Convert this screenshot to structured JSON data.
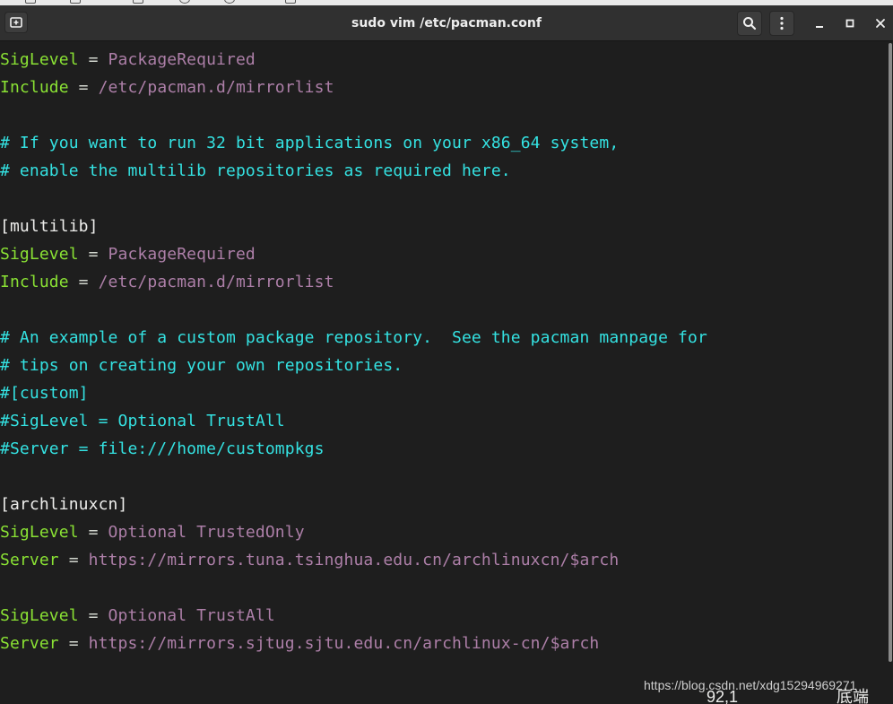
{
  "window": {
    "title": "sudo vim /etc/pacman.conf"
  },
  "titlebar": {
    "new_tab_icon": "new-tab-icon",
    "search_icon": "search-icon",
    "menu_icon": "kebab-menu-icon",
    "minimize_icon": "minimize-icon",
    "maximize_icon": "maximize-icon",
    "close_icon": "close-icon"
  },
  "editor": {
    "lines": [
      {
        "key": "SigLevel",
        "op": " = ",
        "value": "PackageRequired"
      },
      {
        "key": "Include",
        "op": " = ",
        "value": "/etc/pacman.d/mirrorlist"
      },
      {
        "comment": "# If you want to run 32 bit applications on your x86_64 system,"
      },
      {
        "comment": "# enable the multilib repositories as required here."
      },
      {
        "section": "[multilib]"
      },
      {
        "key": "SigLevel",
        "op": " = ",
        "value": "PackageRequired"
      },
      {
        "key": "Include",
        "op": " = ",
        "value": "/etc/pacman.d/mirrorlist"
      },
      {
        "comment": "# An example of a custom package repository.  See the pacman manpage for"
      },
      {
        "comment": "# tips on creating your own repositories."
      },
      {
        "comment": "#[custom]"
      },
      {
        "comment": "#SigLevel = Optional TrustAll"
      },
      {
        "comment": "#Server = file:///home/custompkgs"
      },
      {
        "section": "[archlinuxcn]"
      },
      {
        "key": "SigLevel",
        "op": " = ",
        "value": "Optional TrustedOnly"
      },
      {
        "key": "Server",
        "op": " = ",
        "value": "https://mirrors.tuna.tsinghua.edu.cn/archlinuxcn/$arch"
      },
      {
        "key": "SigLevel",
        "op": " = ",
        "value": "Optional TrustAll"
      },
      {
        "key": "Server",
        "op": " = ",
        "value": "https://mirrors.sjtug.sjtu.edu.cn/archlinux-cn/$arch"
      }
    ]
  },
  "statusline": {
    "cursor_position": "92,1",
    "scroll_position": "底端"
  },
  "watermark": "https://blog.csdn.net/xdg15294969271",
  "colors": {
    "background": "#1e1e1e",
    "keyword": "#8ae234",
    "value": "#ad7fa8",
    "comment": "#34e2e2",
    "text": "#eeeeec"
  }
}
